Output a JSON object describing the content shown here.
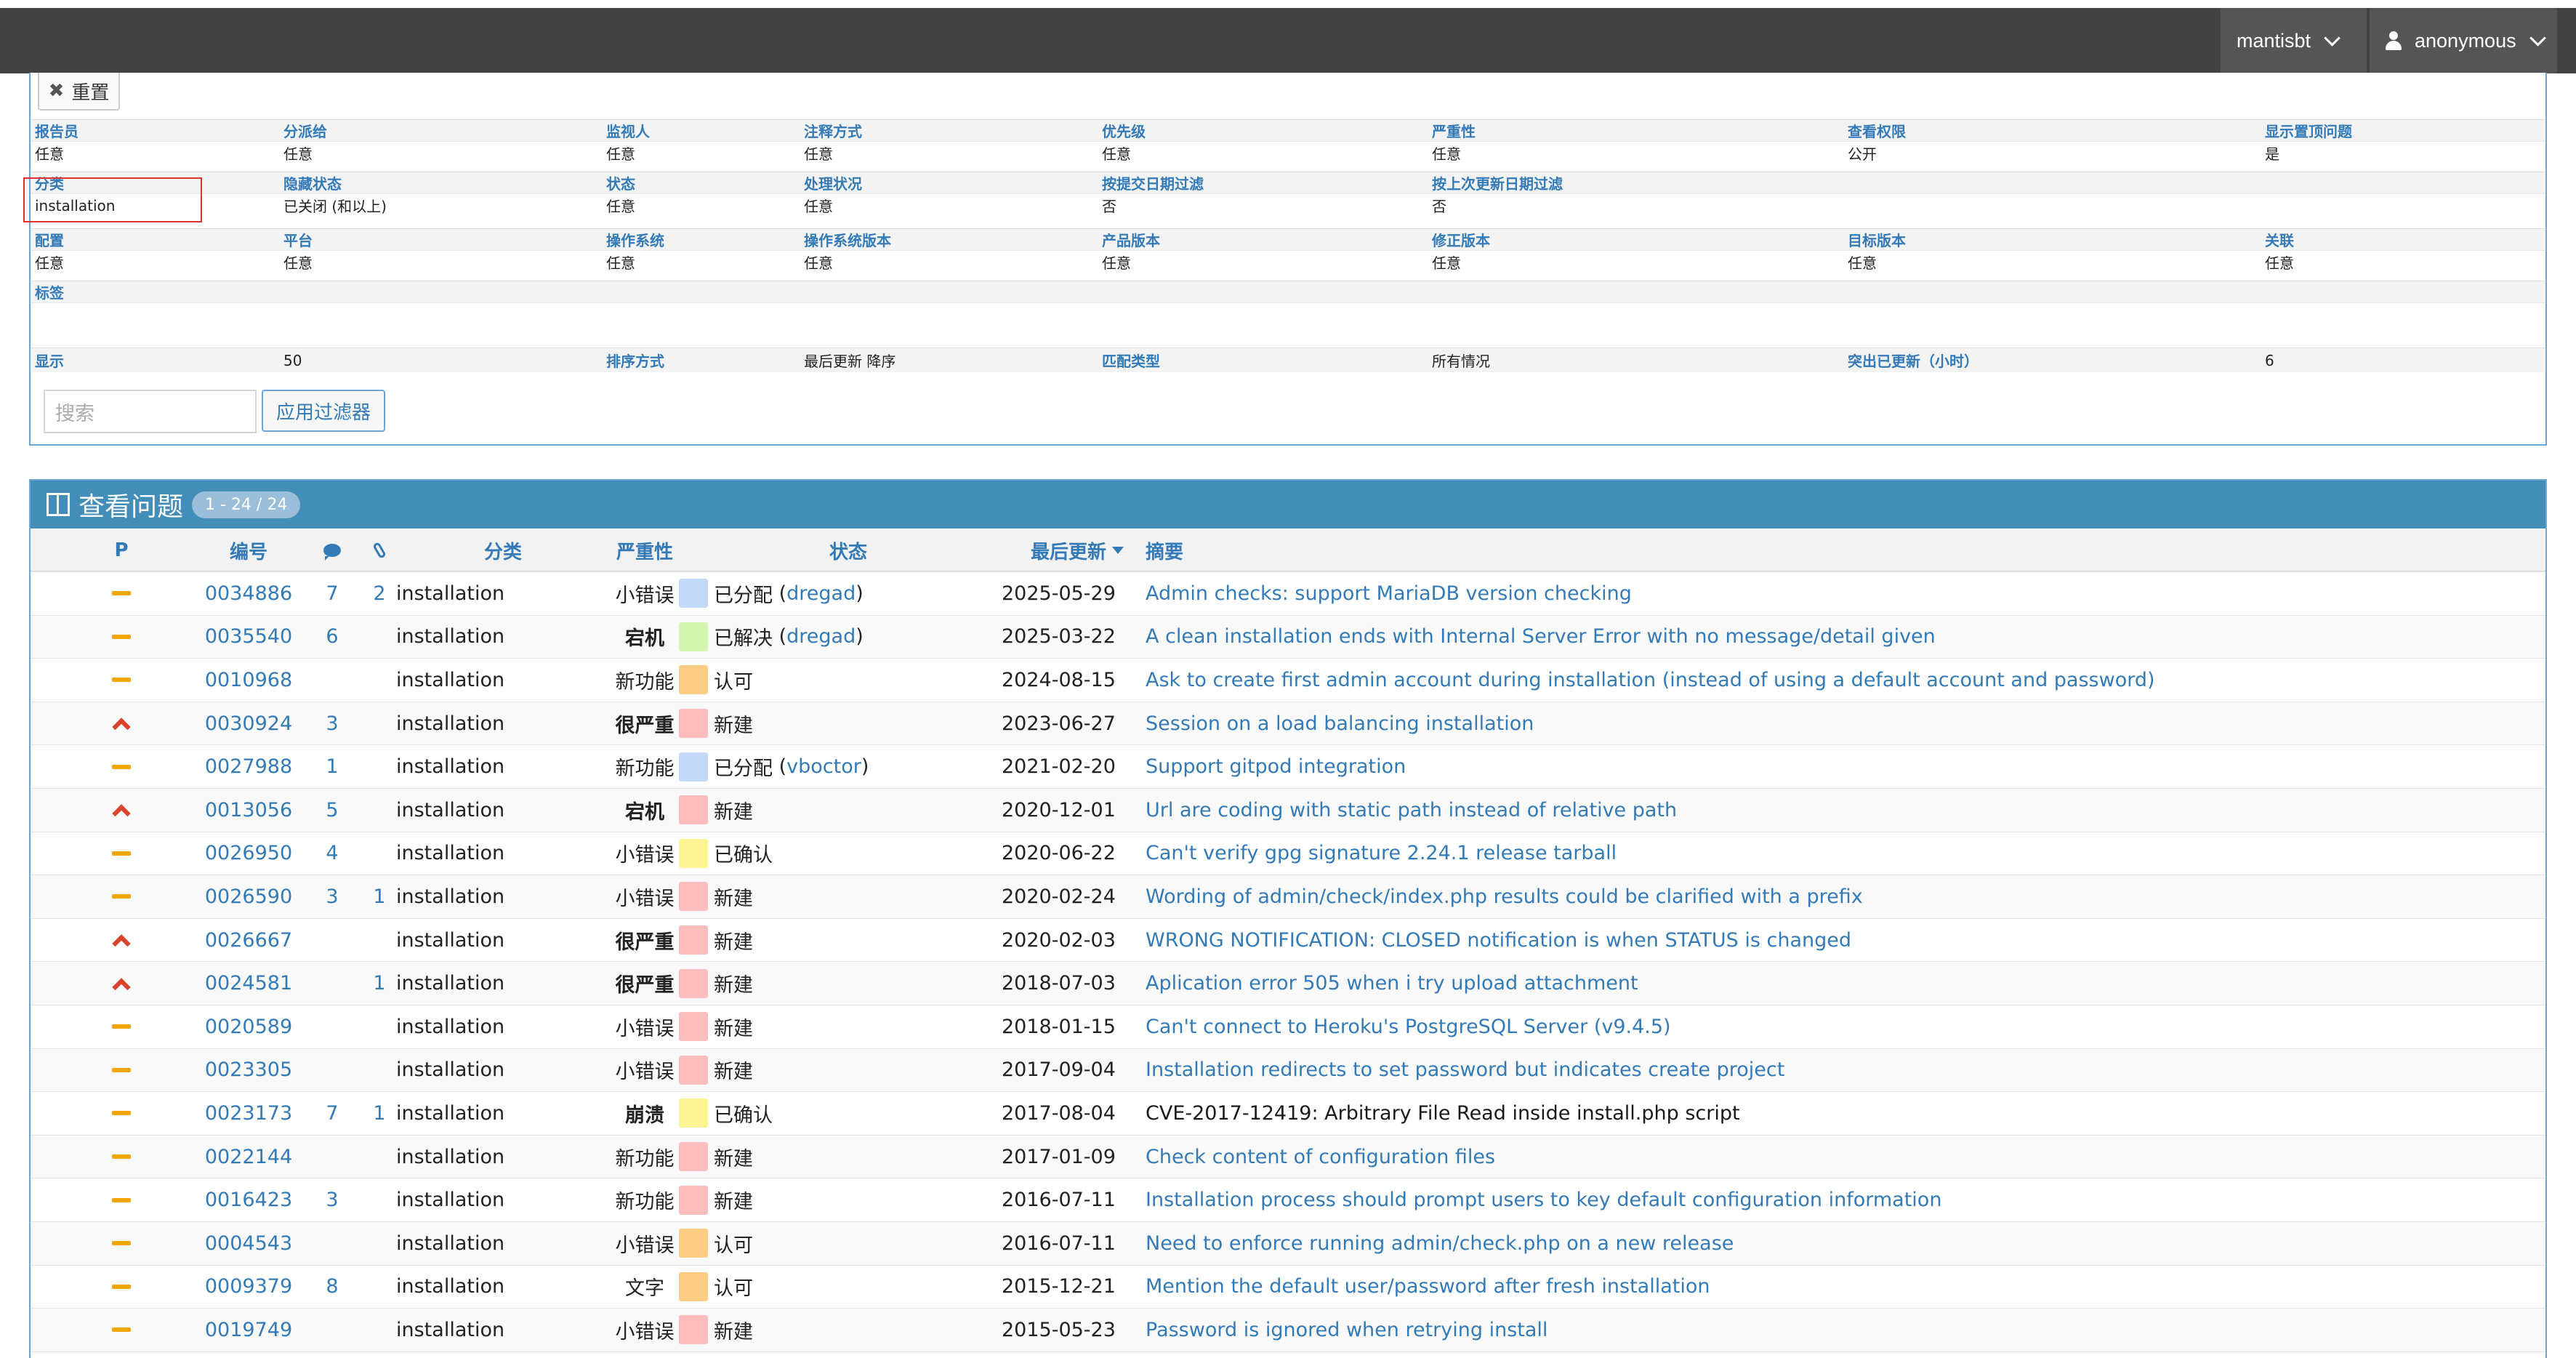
{
  "navbar": {
    "project": "mantisbt",
    "user": "anonymous"
  },
  "filter": {
    "reset_label": "重置",
    "rows": [
      {
        "labels": [
          "报告员",
          "分派给",
          "监视人",
          "注释方式",
          "优先级",
          "严重性",
          "查看权限",
          "显示置顶问题"
        ],
        "values": [
          "任意",
          "任意",
          "任意",
          "任意",
          "任意",
          "任意",
          "公开",
          "是"
        ]
      },
      {
        "labels": [
          "分类",
          "隐藏状态",
          "状态",
          "处理状况",
          "按提交日期过滤",
          "按上次更新日期过滤",
          "",
          ""
        ],
        "values": [
          "installation",
          "已关闭 (和以上)",
          "任意",
          "任意",
          "否",
          "否",
          "",
          ""
        ]
      },
      {
        "labels": [
          "配置",
          "平台",
          "操作系统",
          "操作系统版本",
          "产品版本",
          "修正版本",
          "目标版本",
          "关联"
        ],
        "values": [
          "任意",
          "任意",
          "任意",
          "任意",
          "任意",
          "任意",
          "任意",
          "任意"
        ]
      },
      {
        "labels": [
          "标签",
          "",
          "",
          "",
          "",
          "",
          "",
          ""
        ],
        "values": [
          "",
          "",
          "",
          "",
          "",
          "",
          "",
          ""
        ]
      }
    ],
    "display_row": [
      "显示",
      "50",
      "排序方式",
      "最后更新 降序",
      "匹配类型",
      "所有情况",
      "突出已更新（小时）",
      "6"
    ],
    "search_placeholder": "搜索",
    "apply_label": "应用过滤器"
  },
  "issues": {
    "title": "查看问题",
    "count": "1 - 24 / 24",
    "headers": {
      "p": "P",
      "id": "编号",
      "category": "分类",
      "severity": "严重性",
      "status": "状态",
      "updated": "最后更新",
      "summary": "摘要"
    },
    "rows": [
      {
        "prio": "normal",
        "id": "0034886",
        "notes": "7",
        "files": "2",
        "category": "installation",
        "severity": "小错误",
        "sev_bold": false,
        "status": "已分配",
        "handler": "dregad",
        "color": "#c2daf7",
        "updated": "2025-05-29",
        "summary": "Admin checks: support MariaDB version checking"
      },
      {
        "prio": "normal",
        "id": "0035540",
        "notes": "6",
        "files": "",
        "category": "installation",
        "severity": "宕机",
        "sev_bold": true,
        "status": "已解决",
        "handler": "dregad",
        "color": "#d2f5b0",
        "updated": "2025-03-22",
        "summary": "A clean installation ends with Internal Server Error with no message/detail given"
      },
      {
        "prio": "normal",
        "id": "0010968",
        "notes": "",
        "files": "",
        "category": "installation",
        "severity": "新功能",
        "sev_bold": false,
        "status": "认可",
        "handler": "",
        "color": "#ffcd85",
        "updated": "2024-08-15",
        "summary": "Ask to create first admin account during installation (instead of using a default account and password)"
      },
      {
        "prio": "high",
        "id": "0030924",
        "notes": "3",
        "files": "",
        "category": "installation",
        "severity": "很严重",
        "sev_bold": true,
        "status": "新建",
        "handler": "",
        "color": "#fcbdbd",
        "updated": "2023-06-27",
        "summary": "Session on a load balancing installation"
      },
      {
        "prio": "normal",
        "id": "0027988",
        "notes": "1",
        "files": "",
        "category": "installation",
        "severity": "新功能",
        "sev_bold": false,
        "status": "已分配",
        "handler": "vboctor",
        "color": "#c2daf7",
        "updated": "2021-02-20",
        "summary": "Support gitpod integration"
      },
      {
        "prio": "high",
        "id": "0013056",
        "notes": "5",
        "files": "",
        "category": "installation",
        "severity": "宕机",
        "sev_bold": true,
        "status": "新建",
        "handler": "",
        "color": "#fcbdbd",
        "updated": "2020-12-01",
        "summary": "Url are coding with static path instead of relative path"
      },
      {
        "prio": "normal",
        "id": "0026950",
        "notes": "4",
        "files": "",
        "category": "installation",
        "severity": "小错误",
        "sev_bold": false,
        "status": "已确认",
        "handler": "",
        "color": "#fff494",
        "updated": "2020-06-22",
        "summary": "Can't verify gpg signature 2.24.1 release tarball"
      },
      {
        "prio": "normal",
        "id": "0026590",
        "notes": "3",
        "files": "1",
        "category": "installation",
        "severity": "小错误",
        "sev_bold": false,
        "status": "新建",
        "handler": "",
        "color": "#fcbdbd",
        "updated": "2020-02-24",
        "summary": "Wording of admin/check/index.php results could be clarified with a prefix"
      },
      {
        "prio": "high",
        "id": "0026667",
        "notes": "",
        "files": "",
        "category": "installation",
        "severity": "很严重",
        "sev_bold": true,
        "status": "新建",
        "handler": "",
        "color": "#fcbdbd",
        "updated": "2020-02-03",
        "summary": "WRONG NOTIFICATION: CLOSED notification is when STATUS is changed"
      },
      {
        "prio": "high",
        "id": "0024581",
        "notes": "",
        "files": "1",
        "category": "installation",
        "severity": "很严重",
        "sev_bold": true,
        "status": "新建",
        "handler": "",
        "color": "#fcbdbd",
        "updated": "2018-07-03",
        "summary": "Aplication error 505 when i try upload attachment"
      },
      {
        "prio": "normal",
        "id": "0020589",
        "notes": "",
        "files": "",
        "category": "installation",
        "severity": "小错误",
        "sev_bold": false,
        "status": "新建",
        "handler": "",
        "color": "#fcbdbd",
        "updated": "2018-01-15",
        "summary": "Can't connect to Heroku's PostgreSQL Server (v9.4.5)"
      },
      {
        "prio": "normal",
        "id": "0023305",
        "notes": "",
        "files": "",
        "category": "installation",
        "severity": "小错误",
        "sev_bold": false,
        "status": "新建",
        "handler": "",
        "color": "#fcbdbd",
        "updated": "2017-09-04",
        "summary": "Installation redirects to set password but indicates create project"
      },
      {
        "prio": "normal",
        "id": "0023173",
        "notes": "7",
        "files": "1",
        "category": "installation",
        "severity": "崩溃",
        "sev_bold": true,
        "status": "已确认",
        "handler": "",
        "color": "#fff494",
        "updated": "2017-08-04",
        "summary": "CVE-2017-12419: Arbitrary File Read inside install.php script",
        "summary_dark": true
      },
      {
        "prio": "normal",
        "id": "0022144",
        "notes": "",
        "files": "",
        "category": "installation",
        "severity": "新功能",
        "sev_bold": false,
        "status": "新建",
        "handler": "",
        "color": "#fcbdbd",
        "updated": "2017-01-09",
        "summary": "Check content of configuration files"
      },
      {
        "prio": "normal",
        "id": "0016423",
        "notes": "3",
        "files": "",
        "category": "installation",
        "severity": "新功能",
        "sev_bold": false,
        "status": "新建",
        "handler": "",
        "color": "#fcbdbd",
        "updated": "2016-07-11",
        "summary": "Installation process should prompt users to key default configuration information"
      },
      {
        "prio": "normal",
        "id": "0004543",
        "notes": "",
        "files": "",
        "category": "installation",
        "severity": "小错误",
        "sev_bold": false,
        "status": "认可",
        "handler": "",
        "color": "#ffcd85",
        "updated": "2016-07-11",
        "summary": "Need to enforce running admin/check.php on a new release"
      },
      {
        "prio": "normal",
        "id": "0009379",
        "notes": "8",
        "files": "",
        "category": "installation",
        "severity": "文字",
        "sev_bold": false,
        "status": "认可",
        "handler": "",
        "color": "#ffcd85",
        "updated": "2015-12-21",
        "summary": "Mention the default user/password after fresh installation"
      },
      {
        "prio": "normal",
        "id": "0019749",
        "notes": "",
        "files": "",
        "category": "installation",
        "severity": "小错误",
        "sev_bold": false,
        "status": "新建",
        "handler": "",
        "color": "#fcbdbd",
        "updated": "2015-05-23",
        "summary": "Password is ignored when retrying install"
      }
    ]
  }
}
